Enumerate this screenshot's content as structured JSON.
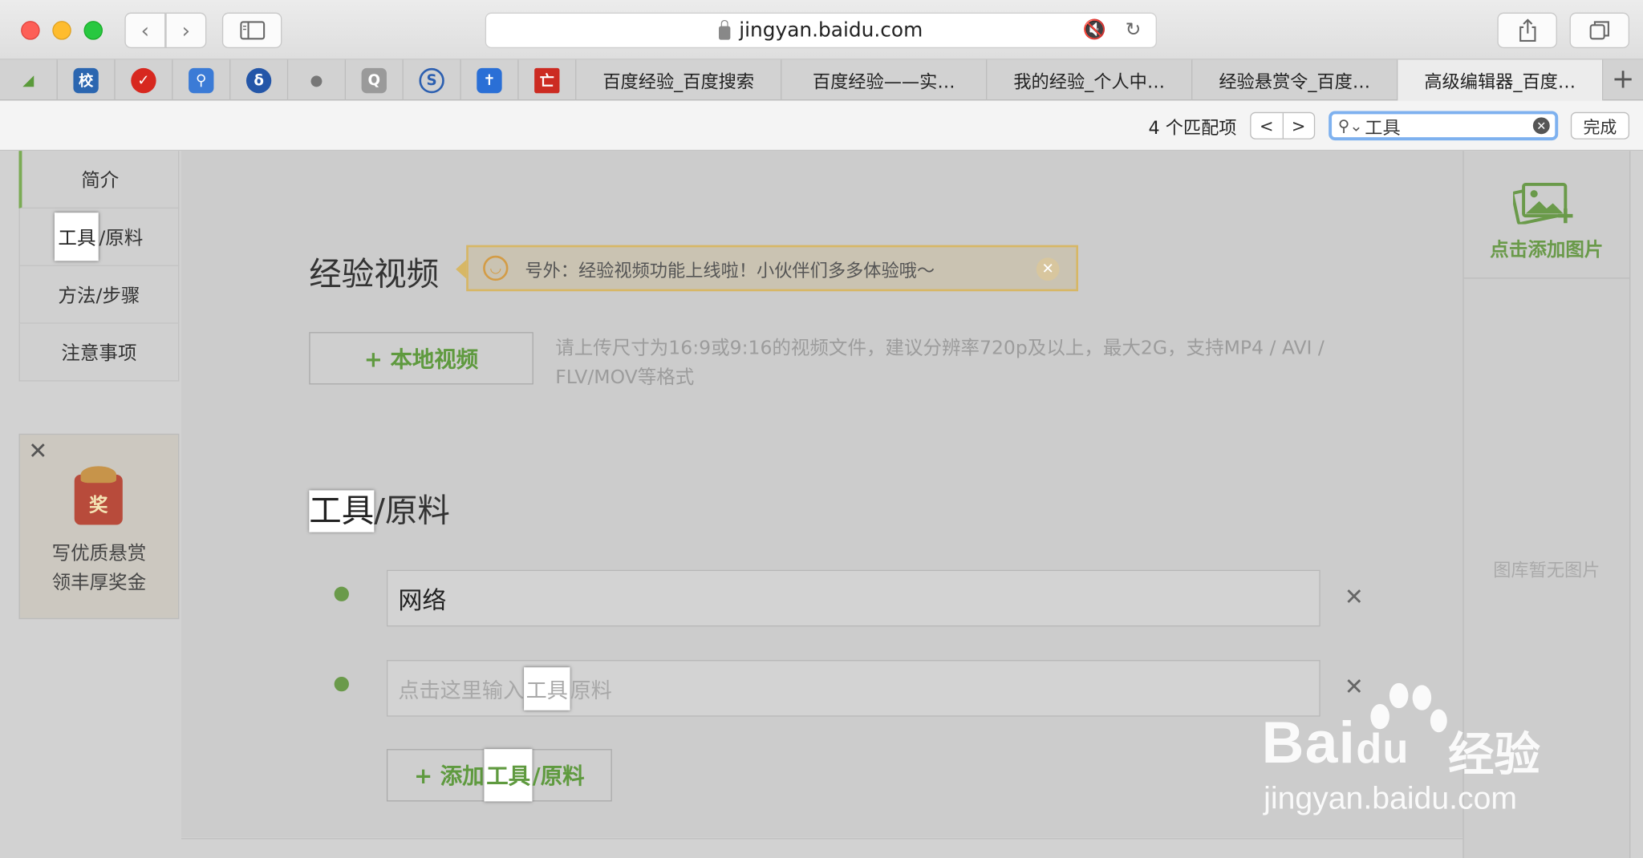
{
  "browser": {
    "url": "jingyan.baidu.com",
    "tabs": [
      "百度经验_百度搜索",
      "百度经验——实…",
      "我的经验_个人中…",
      "经验悬赏令_百度…",
      "高级编辑器_百度…"
    ],
    "new_tab": "+",
    "favorites": [
      "green-leaf-icon",
      "school-icon",
      "red-swoosh-icon",
      "image-search-icon",
      "blue-flame-icon",
      "apple-icon",
      "q-icon",
      "blue-s-icon",
      "cross-icon",
      "red-logo-icon"
    ]
  },
  "findbar": {
    "count": "4 个匹配项",
    "prev": "<",
    "next": ">",
    "query": "工具",
    "done": "完成"
  },
  "sidebar": {
    "items": [
      "简介",
      "工具/原料",
      "方法/步骤",
      "注意事项"
    ],
    "item_tool_hl": "工具",
    "item_tool_rest": "/原料"
  },
  "promo": {
    "badge": "奖",
    "line1": "写优质悬赏",
    "line2": "领丰厚奖金"
  },
  "video": {
    "title": "经验视频",
    "notice": "号外：经验视频功能上线啦！小伙伴们多多体验哦～",
    "upload_button": "+ 本地视频",
    "hint": "请上传尺寸为16:9或9:16的视频文件，建议分辨率720p及以上，最大2G，支持MP4 / AVI / FLV/MOV等格式"
  },
  "tools": {
    "title_hl": "工具",
    "title_rest": "/原料",
    "item1_value": "网络",
    "item2_ph_pre": "点击这里输入",
    "item2_ph_hl": "工具",
    "item2_ph_post": "原料",
    "remove": "✕",
    "add_pre": "+ 添加",
    "add_hl": "工具",
    "add_post": "/原料"
  },
  "gallery": {
    "add_label": "点击添加图片",
    "empty": "图库暂无图片"
  },
  "watermark": {
    "brand": "Bai",
    "brand2": "du",
    "cn": "经验",
    "url": "jingyan.baidu.com"
  },
  "colors": {
    "accent_green": "#6a9a4a",
    "notice_border": "#d7b765",
    "find_focus": "#7eb1ef"
  }
}
